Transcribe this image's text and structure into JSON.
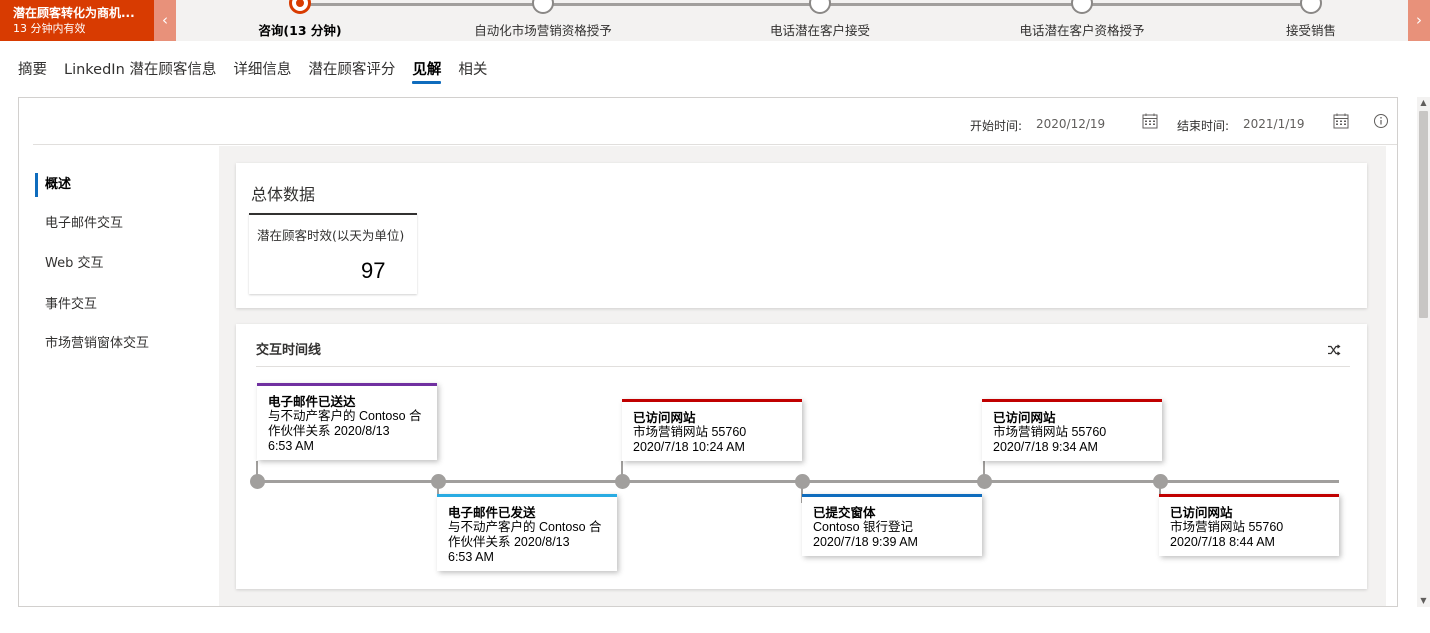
{
  "process": {
    "active_title": "潜在顾客转化为商机...",
    "active_subtitle": "13 分钟内有效",
    "stages": [
      {
        "label": "咨询(13 分钟)",
        "current": true
      },
      {
        "label": "自动化市场营销资格授予",
        "current": false
      },
      {
        "label": "电话潜在客户接受",
        "current": false
      },
      {
        "label": "电话潜在客户资格授予",
        "current": false
      },
      {
        "label": "接受销售",
        "current": false
      }
    ],
    "prev_icon": "chevron-left-icon",
    "next_icon": "chevron-right-icon",
    "accent_color": "#d83b01"
  },
  "tabs": [
    {
      "label": "摘要",
      "active": false
    },
    {
      "label": "LinkedIn 潜在顾客信息",
      "active": false
    },
    {
      "label": "详细信息",
      "active": false
    },
    {
      "label": "潜在顾客评分",
      "active": false
    },
    {
      "label": "见解",
      "active": true
    },
    {
      "label": "相关",
      "active": false
    }
  ],
  "filters": {
    "start_label": "开始时间:",
    "start_value": "2020/12/19",
    "end_label": "结束时间:",
    "end_value": "2021/1/19",
    "calendar_icon": "calendar-icon",
    "info_icon": "info-icon"
  },
  "left_nav": [
    {
      "label": "概述",
      "active": true
    },
    {
      "label": "电子邮件交互",
      "active": false
    },
    {
      "label": "Web 交互",
      "active": false
    },
    {
      "label": "事件交互",
      "active": false
    },
    {
      "label": "市场营销窗体交互",
      "active": false
    }
  ],
  "overall": {
    "title": "总体数据",
    "metric_label": "潜在顾客时效(以天为单位)",
    "metric_value": "97"
  },
  "timeline": {
    "title": "交互时间线",
    "shuffle_icon": "shuffle-icon",
    "events": [
      {
        "title": "电子邮件已送达",
        "desc": "与不动产客户的 Contoso 合作伙伴关系 2020/8/13",
        "time": "6:53 AM",
        "color": "#7030a0",
        "position": "above"
      },
      {
        "title": "电子邮件已发送",
        "desc": "与不动产客户的 Contoso 合作伙伴关系 2020/8/13",
        "time": "6:53 AM",
        "color": "#29abe2",
        "position": "below"
      },
      {
        "title": "已访问网站",
        "desc": "市场营销网站 55760",
        "time": "2020/7/18 10:24 AM",
        "color": "#c00000",
        "position": "above"
      },
      {
        "title": "已提交窗体",
        "desc": "Contoso 银行登记",
        "time": "2020/7/18 9:39 AM",
        "color": "#0f6cbd",
        "position": "below"
      },
      {
        "title": "已访问网站",
        "desc": "市场营销网站 55760",
        "time": "2020/7/18 9:34 AM",
        "color": "#c00000",
        "position": "above"
      },
      {
        "title": "已访问网站",
        "desc": "市场营销网站 55760",
        "time": "2020/7/18 8:44 AM",
        "color": "#c00000",
        "position": "below"
      }
    ]
  }
}
